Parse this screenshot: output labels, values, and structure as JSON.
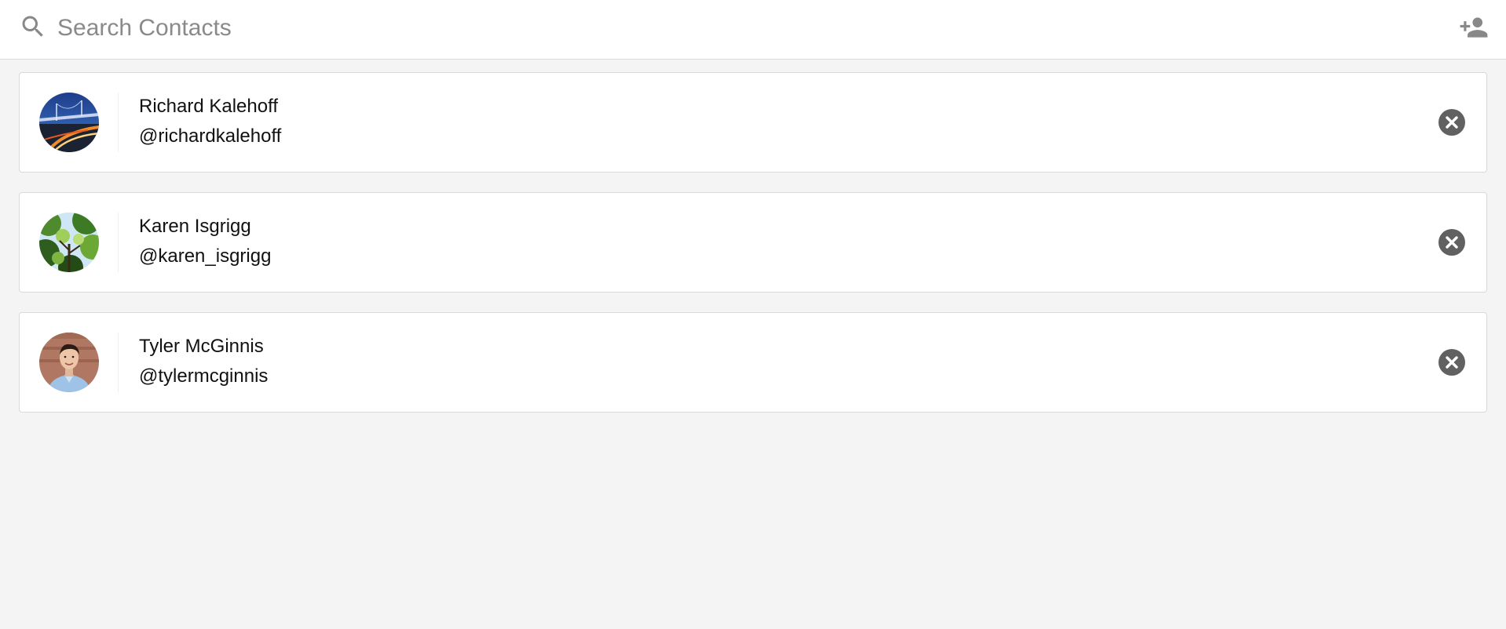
{
  "search": {
    "placeholder": "Search Contacts",
    "value": "",
    "icon": "search-icon"
  },
  "header": {
    "add_contact_icon": "person-add-icon"
  },
  "contacts": [
    {
      "name": "Richard Kalehoff",
      "handle": "@richardkalehoff",
      "avatar": "bridge-at-night-photo"
    },
    {
      "name": "Karen Isgrigg",
      "handle": "@karen_isgrigg",
      "avatar": "tree-canopy-photo"
    },
    {
      "name": "Tyler McGinnis",
      "handle": "@tylermcginnis",
      "avatar": "man-portrait-photo"
    }
  ],
  "colors": {
    "background": "#f4f4f4",
    "card": "#ffffff",
    "icon_gray": "#777777",
    "remove_button": "#616161"
  }
}
